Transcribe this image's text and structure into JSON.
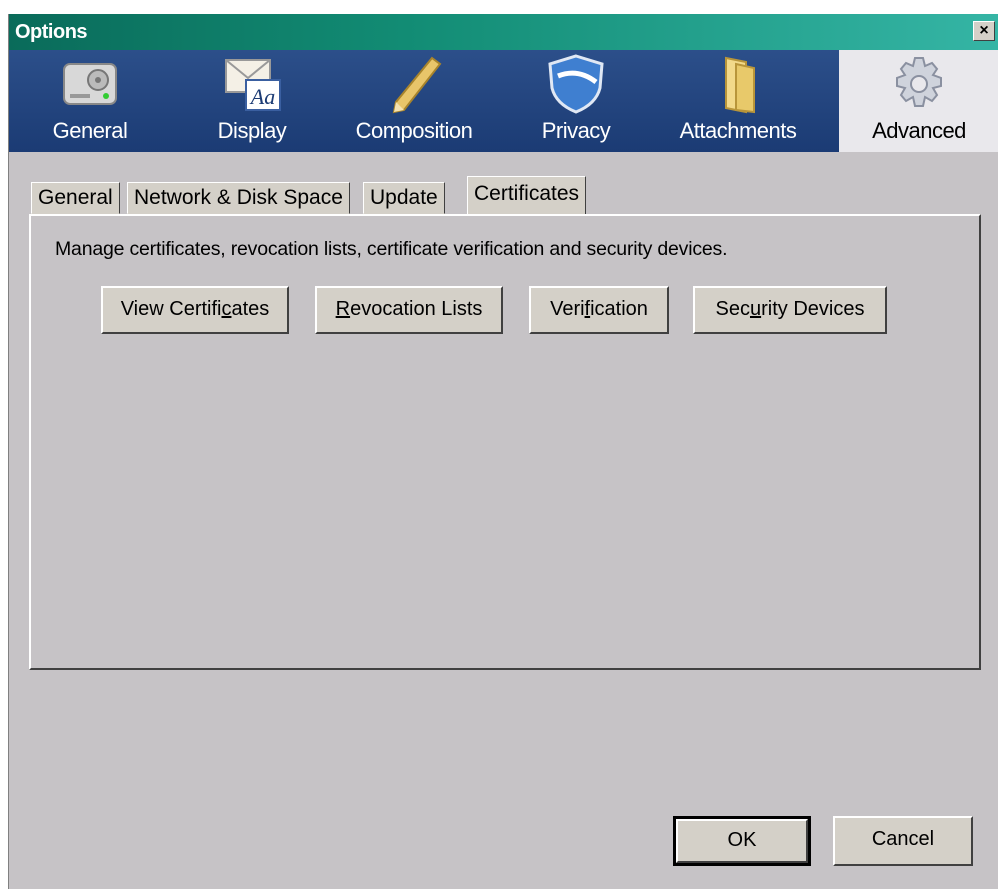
{
  "window": {
    "title": "Options",
    "close_glyph": "×"
  },
  "toolbar": {
    "items": [
      {
        "label": "General",
        "icon": "hard-drive-icon"
      },
      {
        "label": "Display",
        "icon": "envelope-font-icon"
      },
      {
        "label": "Composition",
        "icon": "pencil-icon"
      },
      {
        "label": "Privacy",
        "icon": "shield-icon"
      },
      {
        "label": "Attachments",
        "icon": "folder-icon"
      },
      {
        "label": "Advanced",
        "icon": "gear-icon",
        "active": true
      }
    ]
  },
  "tabs": [
    {
      "label": "General"
    },
    {
      "label": "Network & Disk Space"
    },
    {
      "label": "Update"
    },
    {
      "label": "Certificates",
      "active": true
    }
  ],
  "certificates": {
    "description": "Manage certificates, revocation lists, certificate verification and security devices.",
    "buttons": [
      {
        "pre": "View Certifi",
        "accel": "c",
        "post": "ates"
      },
      {
        "pre": "",
        "accel": "R",
        "post": "evocation Lists"
      },
      {
        "pre": "Veri",
        "accel": "f",
        "post": "ication"
      },
      {
        "pre": "Sec",
        "accel": "u",
        "post": "rity Devices"
      }
    ]
  },
  "footer": {
    "ok_label": "OK",
    "cancel_label": "Cancel"
  },
  "colors": {
    "titlebar": "#128c74",
    "toolbar": "#1e3d77",
    "face": "#c6c3c6"
  }
}
